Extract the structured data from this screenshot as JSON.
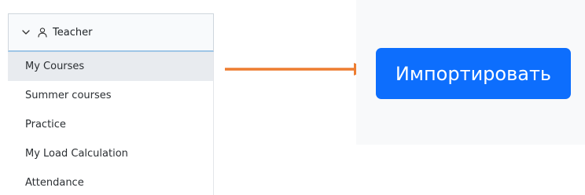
{
  "sidebar": {
    "header": {
      "label": "Teacher",
      "expand_icon": "chevron-down-icon",
      "role_icon": "user-icon"
    },
    "items": [
      {
        "label": "My Courses",
        "active": true
      },
      {
        "label": "Summer courses",
        "active": false
      },
      {
        "label": "Practice",
        "active": false
      },
      {
        "label": "My Load Calculation",
        "active": false
      },
      {
        "label": "Attendance",
        "active": false
      }
    ]
  },
  "annotation": {
    "arrow_icon": "arrow-right-icon",
    "arrow_color": "#ed7d31"
  },
  "import_panel": {
    "button_label": "Импортировать",
    "button_color": "#0d6efd"
  }
}
